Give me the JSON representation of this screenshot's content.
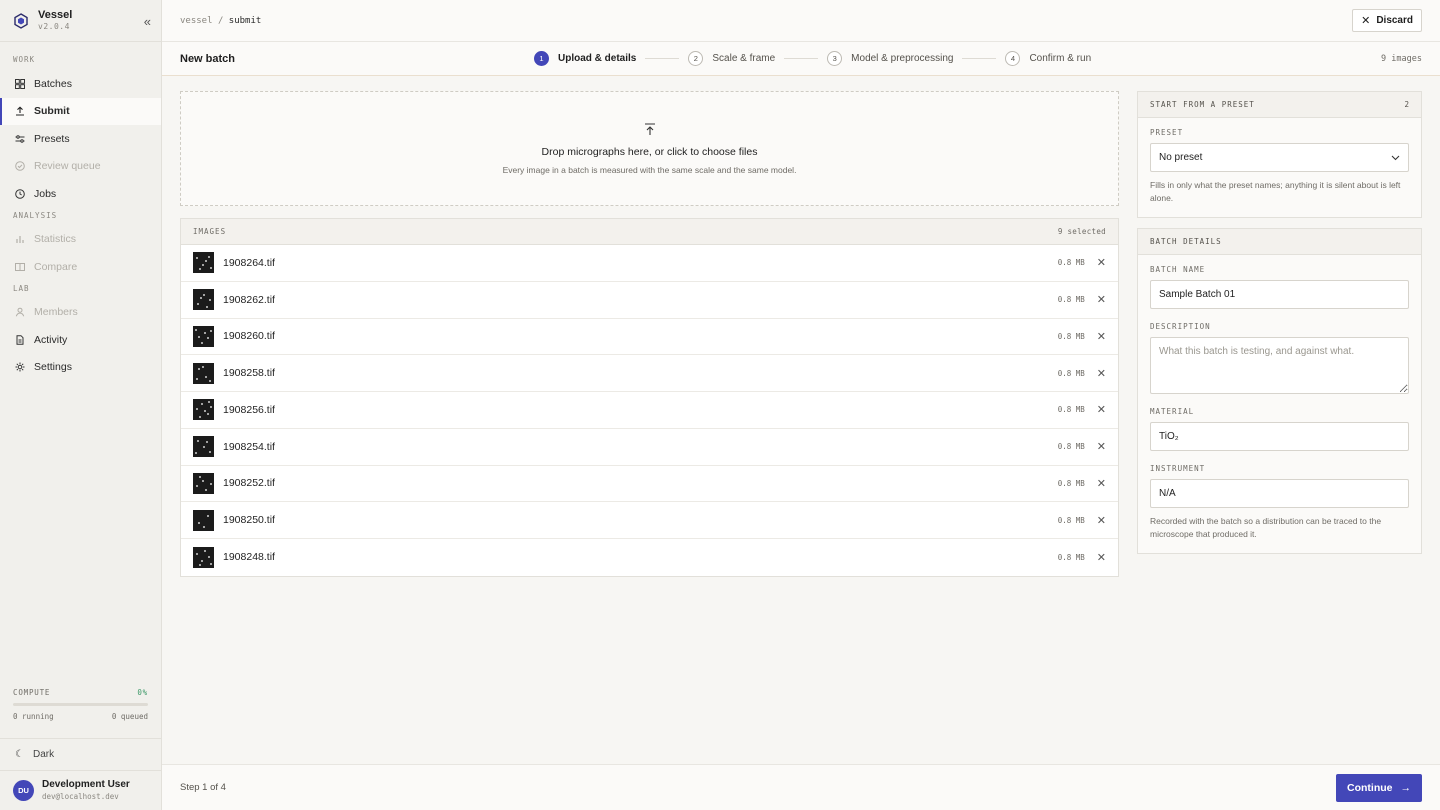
{
  "app": {
    "name": "Vessel",
    "version": "v2.0.4"
  },
  "icons": {
    "collapse": "double-chevron-left-icon",
    "logo": "hexagon-logo-icon",
    "upload": "upload-arrow-icon",
    "close": "x-icon",
    "chevron": "chevron-down-icon",
    "arrow": "arrow-right-icon",
    "moon": "moon-icon"
  },
  "nav": {
    "sections": {
      "work": "WORK",
      "analysis": "ANALYSIS",
      "lab": "LAB"
    },
    "items": {
      "batches": "Batches",
      "submit": "Submit",
      "presets": "Presets",
      "review": "Review queue",
      "jobs": "Jobs",
      "statistics": "Statistics",
      "compare": "Compare",
      "members": "Members",
      "activity": "Activity",
      "settings": "Settings"
    }
  },
  "compute": {
    "label": "COMPUTE",
    "percent": "0%",
    "running": "0 running",
    "queued": "0 queued",
    "fill_fraction": 0
  },
  "theme": {
    "label": "Dark"
  },
  "user": {
    "initials": "DU",
    "name": "Development User",
    "email": "dev@localhost.dev"
  },
  "breadcrumb": {
    "root": "vessel",
    "sep": "/",
    "current": "submit"
  },
  "header": {
    "discard": "Discard"
  },
  "page": {
    "title": "New batch",
    "image_count": "9 images"
  },
  "steps": [
    {
      "num": "1",
      "label": "Upload & details"
    },
    {
      "num": "2",
      "label": "Scale & frame"
    },
    {
      "num": "3",
      "label": "Model & preprocessing"
    },
    {
      "num": "4",
      "label": "Confirm & run"
    }
  ],
  "dropzone": {
    "title": "Drop micrographs here, or click to choose files",
    "subtitle": "Every image in a batch is measured with the same scale and the same model."
  },
  "images": {
    "header": "IMAGES",
    "selected": "9 selected",
    "files": [
      {
        "name": "1908264.tif",
        "size": "0.8 MB"
      },
      {
        "name": "1908262.tif",
        "size": "0.8 MB"
      },
      {
        "name": "1908260.tif",
        "size": "0.8 MB"
      },
      {
        "name": "1908258.tif",
        "size": "0.8 MB"
      },
      {
        "name": "1908256.tif",
        "size": "0.8 MB"
      },
      {
        "name": "1908254.tif",
        "size": "0.8 MB"
      },
      {
        "name": "1908252.tif",
        "size": "0.8 MB"
      },
      {
        "name": "1908250.tif",
        "size": "0.8 MB"
      },
      {
        "name": "1908248.tif",
        "size": "0.8 MB"
      }
    ]
  },
  "preset": {
    "header": "START FROM A PRESET",
    "count": "2",
    "label": "PRESET",
    "value": "No preset",
    "hint": "Fills in only what the preset names; anything it is silent about is left alone."
  },
  "details": {
    "header": "BATCH DETAILS",
    "name_label": "BATCH NAME",
    "name_value": "Sample Batch 01",
    "desc_label": "DESCRIPTION",
    "desc_placeholder": "What this batch is testing, and against what.",
    "material_label": "MATERIAL",
    "material_value": "TiO₂",
    "instrument_label": "INSTRUMENT",
    "instrument_value": "N/A",
    "instrument_hint": "Recorded with the batch so a distribution can be traced to the microscope that produced it."
  },
  "footer": {
    "step_info": "Step 1 of 4",
    "continue": "Continue"
  },
  "colors": {
    "accent": "#4347b8",
    "compute": "#3f9a6a"
  }
}
